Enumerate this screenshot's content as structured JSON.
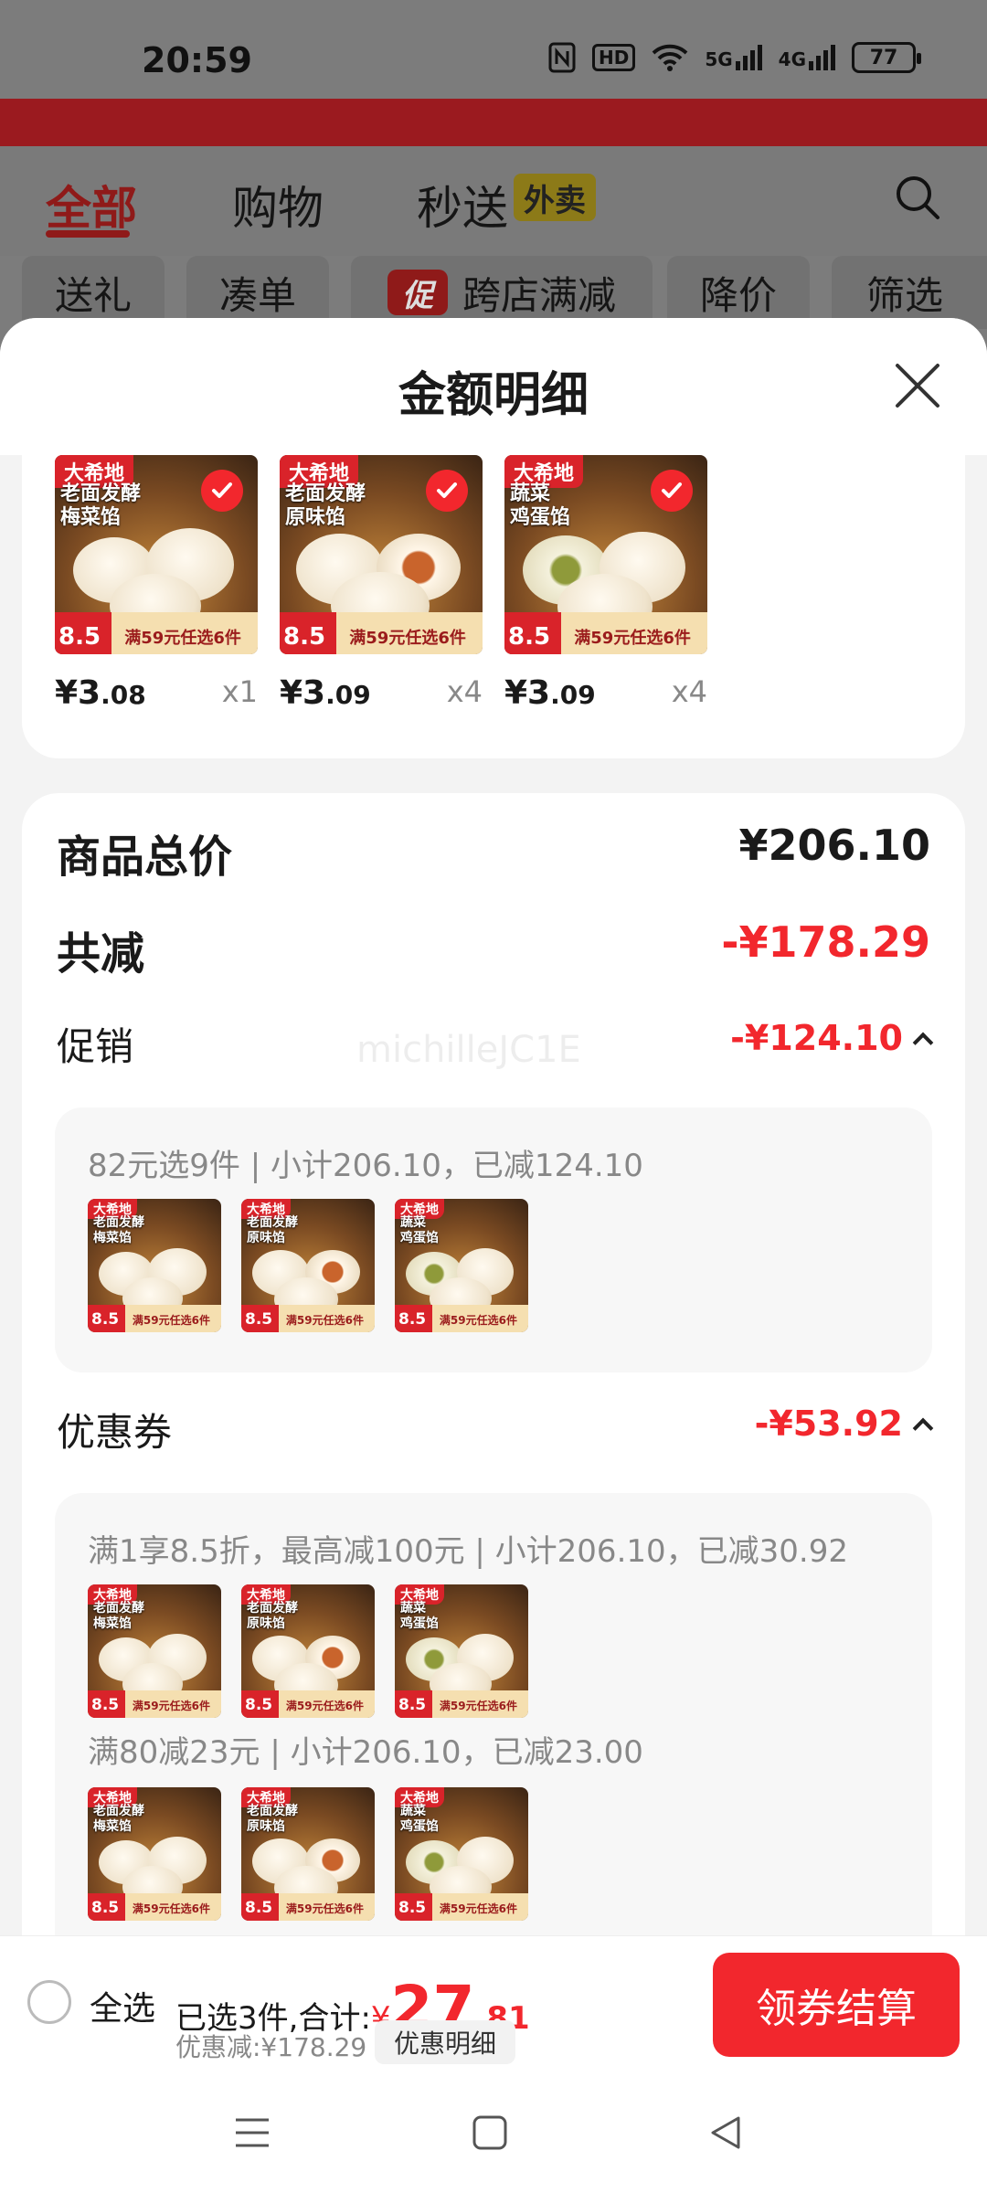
{
  "status_bar": {
    "time": "20:59",
    "hd_label": "HD",
    "sig1_label": "5G",
    "sig2_label": "4G",
    "battery": "77"
  },
  "background_page": {
    "tabs": [
      {
        "label": "全部",
        "active": true
      },
      {
        "label": "购物",
        "active": false
      },
      {
        "label": "秒送",
        "active": false
      }
    ],
    "waimai_badge": "外卖",
    "chips": [
      "送礼",
      "凑单",
      "跨店满减",
      "降价",
      "筛选"
    ],
    "cu_badge": "促"
  },
  "sheet": {
    "title": "金额明细",
    "products": [
      {
        "price_int": "¥3",
        "price_dec": ".08",
        "qty": "x1",
        "name_line1": "老面发酵",
        "name_line2": "梅菜馅"
      },
      {
        "price_int": "¥3",
        "price_dec": ".09",
        "qty": "x4",
        "name_line1": "老面发酵",
        "name_line2": "原味馅"
      },
      {
        "price_int": "¥3",
        "price_dec": ".09",
        "qty": "x4",
        "name_line1": "蔬菜",
        "name_line2": "鸡蛋馅"
      }
    ],
    "product_art": {
      "brand": "大希地",
      "discount": "8.5",
      "promo": "满59元任选6件"
    },
    "total_label": "商品总价",
    "total_value": "¥206.10",
    "reduce_label": "共减",
    "reduce_value": "-¥178.29",
    "watermark": "michilleJC1E",
    "promo_section": {
      "label": "促销",
      "value": "-¥124.10",
      "box_text": "82元选9件 | 小计206.10，已减124.10"
    },
    "coupon_section": {
      "label": "优惠券",
      "value": "-¥53.92",
      "line1": "满1享8.5折，最高减100元 | 小计206.10，已减30.92",
      "line2": "满80减23元 | 小计206.10，已减23.00"
    }
  },
  "bottom_bar": {
    "select_all": "全选",
    "selected_text": "已选3件,合计:",
    "yen": "¥",
    "amount_int": "27",
    "amount_dec": ".81",
    "discount_text": "优惠减:¥178.29",
    "detail_button": "优惠明细",
    "checkout_button": "领券结算"
  },
  "colors": {
    "accent_red": "#f2272d",
    "dim_overlay": "#7c7c7c"
  }
}
